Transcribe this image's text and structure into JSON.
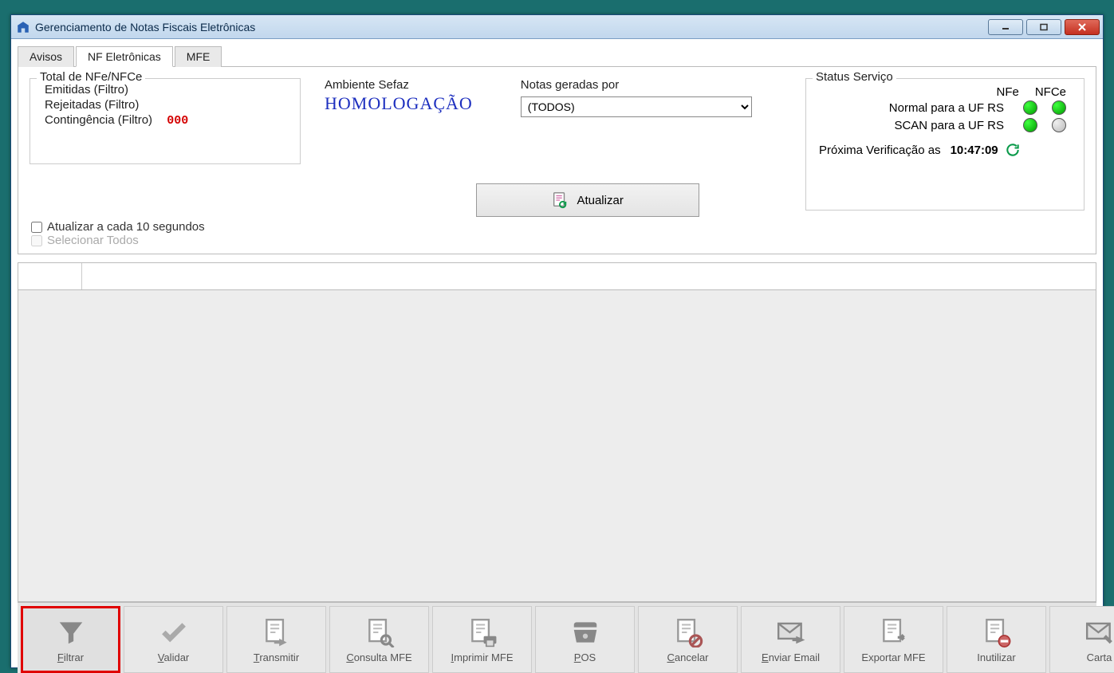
{
  "window": {
    "title": "Gerenciamento de Notas Fiscais Eletrônicas"
  },
  "tabs": [
    "Avisos",
    "NF Eletrônicas",
    "MFE"
  ],
  "active_tab": 1,
  "totals": {
    "legend": "Total de NFe/NFCe",
    "emitidas": "Emitidas (Filtro)",
    "rejeitadas": "Rejeitadas (Filtro)",
    "contingencia_label": "Contingência (Filtro)",
    "contingencia_value": "000"
  },
  "ambiente": {
    "label": "Ambiente Sefaz",
    "value": "HOMOLOGAÇÃO"
  },
  "notas": {
    "label": "Notas geradas por",
    "selected": "(TODOS)",
    "options": [
      "(TODOS)"
    ]
  },
  "checks": {
    "auto_update": "Atualizar a cada 10 segundos",
    "select_all": "Selecionar Todos"
  },
  "atualizar_btn": "Atualizar",
  "status": {
    "legend": "Status Serviço",
    "col_nfe": "NFe",
    "col_nfce": "NFCe",
    "row_normal": "Normal para a UF RS",
    "row_scan": "SCAN para a UF RS",
    "normal_nfe": "green",
    "normal_nfce": "green",
    "scan_nfe": "green",
    "scan_nfce": "gray",
    "prox_label": "Próxima Verificação as",
    "prox_time": "10:47:09"
  },
  "toolbar": [
    {
      "label": "Filtrar",
      "icon": "funnel",
      "highlight": true,
      "ul": "F"
    },
    {
      "label": "Validar",
      "icon": "check",
      "ul": "V"
    },
    {
      "label": "Transmitir",
      "icon": "doc-send",
      "ul": "T"
    },
    {
      "label": "Consulta MFE",
      "icon": "doc-search",
      "ul": "C"
    },
    {
      "label": "Imprimir MFE",
      "icon": "doc-print",
      "ul": "I"
    },
    {
      "label": "POS",
      "icon": "pos",
      "ul": "P"
    },
    {
      "label": "Cancelar",
      "icon": "doc-cancel",
      "ul": "C"
    },
    {
      "label": "Enviar Email",
      "icon": "envelope-send",
      "ul": "E"
    },
    {
      "label": "Exportar MFE",
      "icon": "doc-export",
      "ul": ""
    },
    {
      "label": "Inutilizar",
      "icon": "doc-block",
      "ul": ""
    },
    {
      "label": "Carta",
      "icon": "envelope-edit",
      "ul": ""
    }
  ]
}
